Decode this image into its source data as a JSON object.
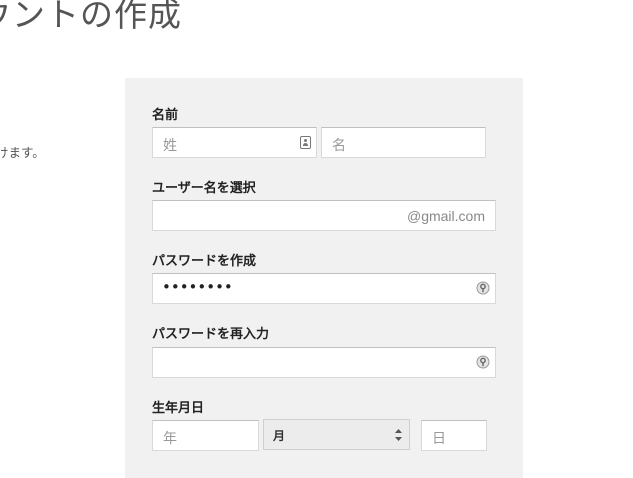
{
  "page": {
    "title": "ウントの作成",
    "left_text": "けます。"
  },
  "form": {
    "name": {
      "label": "名前",
      "last_placeholder": "姓",
      "first_placeholder": "名"
    },
    "username": {
      "label": "ユーザー名を選択",
      "value": "",
      "suffix": "@gmail.com"
    },
    "password": {
      "label": "パスワードを作成",
      "value": "••••••••"
    },
    "password_confirm": {
      "label": "パスワードを再入力",
      "value": ""
    },
    "birthday": {
      "label": "生年月日",
      "year_placeholder": "年",
      "month_value": "月",
      "day_placeholder": "日"
    }
  },
  "icons": {
    "contact": "contact-card-icon",
    "password": "key-icon",
    "select": "up-down-arrows-icon"
  }
}
